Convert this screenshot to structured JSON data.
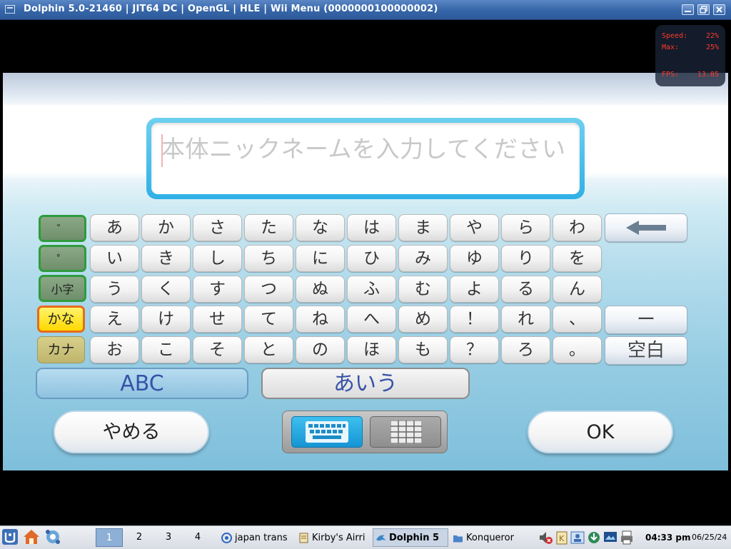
{
  "window": {
    "title": "Dolphin 5.0-21460 | JIT64 DC | OpenGL | HLE | Wii Menu (0000000100000002)",
    "controls": [
      "minimize-icon",
      "maximize-icon",
      "close-icon"
    ]
  },
  "overlay": {
    "speed_label": "Speed:",
    "speed_value": "22%",
    "max_label": "Max:",
    "max_value": "25%",
    "fps_label": "FPS:",
    "fps_value": "13.85"
  },
  "nickname": {
    "placeholder": "本体ニックネームを入力してください",
    "value": ""
  },
  "keyboard": {
    "side_keys": [
      "゛",
      "゜",
      "小字",
      "かな",
      "カナ"
    ],
    "rows": [
      [
        "あ",
        "か",
        "さ",
        "た",
        "な",
        "は",
        "ま",
        "や",
        "ら",
        "わ"
      ],
      [
        "い",
        "き",
        "し",
        "ち",
        "に",
        "ひ",
        "み",
        "ゆ",
        "り",
        "を"
      ],
      [
        "う",
        "く",
        "す",
        "つ",
        "ぬ",
        "ふ",
        "む",
        "よ",
        "る",
        "ん"
      ],
      [
        "え",
        "け",
        "せ",
        "て",
        "ね",
        "へ",
        "め",
        "！",
        "れ",
        "、"
      ],
      [
        "お",
        "こ",
        "そ",
        "と",
        "の",
        "ほ",
        "も",
        "？",
        "ろ",
        "。"
      ]
    ],
    "backspace_icon": "left-arrow-icon",
    "dash_key": "ー",
    "space_key": "空白"
  },
  "modes": {
    "abc": "ABC",
    "aiu": "あいう"
  },
  "buttons": {
    "cancel": "やめる",
    "ok": "OK"
  },
  "layout_toggle": {
    "keyboard_icon": "keyboard-icon",
    "grid_icon": "grid-icon",
    "active": "keyboard"
  },
  "taskbar": {
    "desktops": [
      "1",
      "2",
      "3",
      "4"
    ],
    "active_desktop": "1",
    "tasks": [
      {
        "label": "japan trans",
        "icon": "browser-icon"
      },
      {
        "label": "Kirby's Airri",
        "icon": "document-icon"
      },
      {
        "label": "Dolphin 5",
        "icon": "dolphin-icon",
        "active": true
      },
      {
        "label": "Konqueror",
        "icon": "folder-icon"
      }
    ],
    "clock": "04:33 pm",
    "date": "06/25/24"
  },
  "colors": {
    "title_bar": "#3565a8",
    "key_accent": "#2fb0e6",
    "overlay_text": "#ff3b2a",
    "kana_key": "#ffd800"
  }
}
